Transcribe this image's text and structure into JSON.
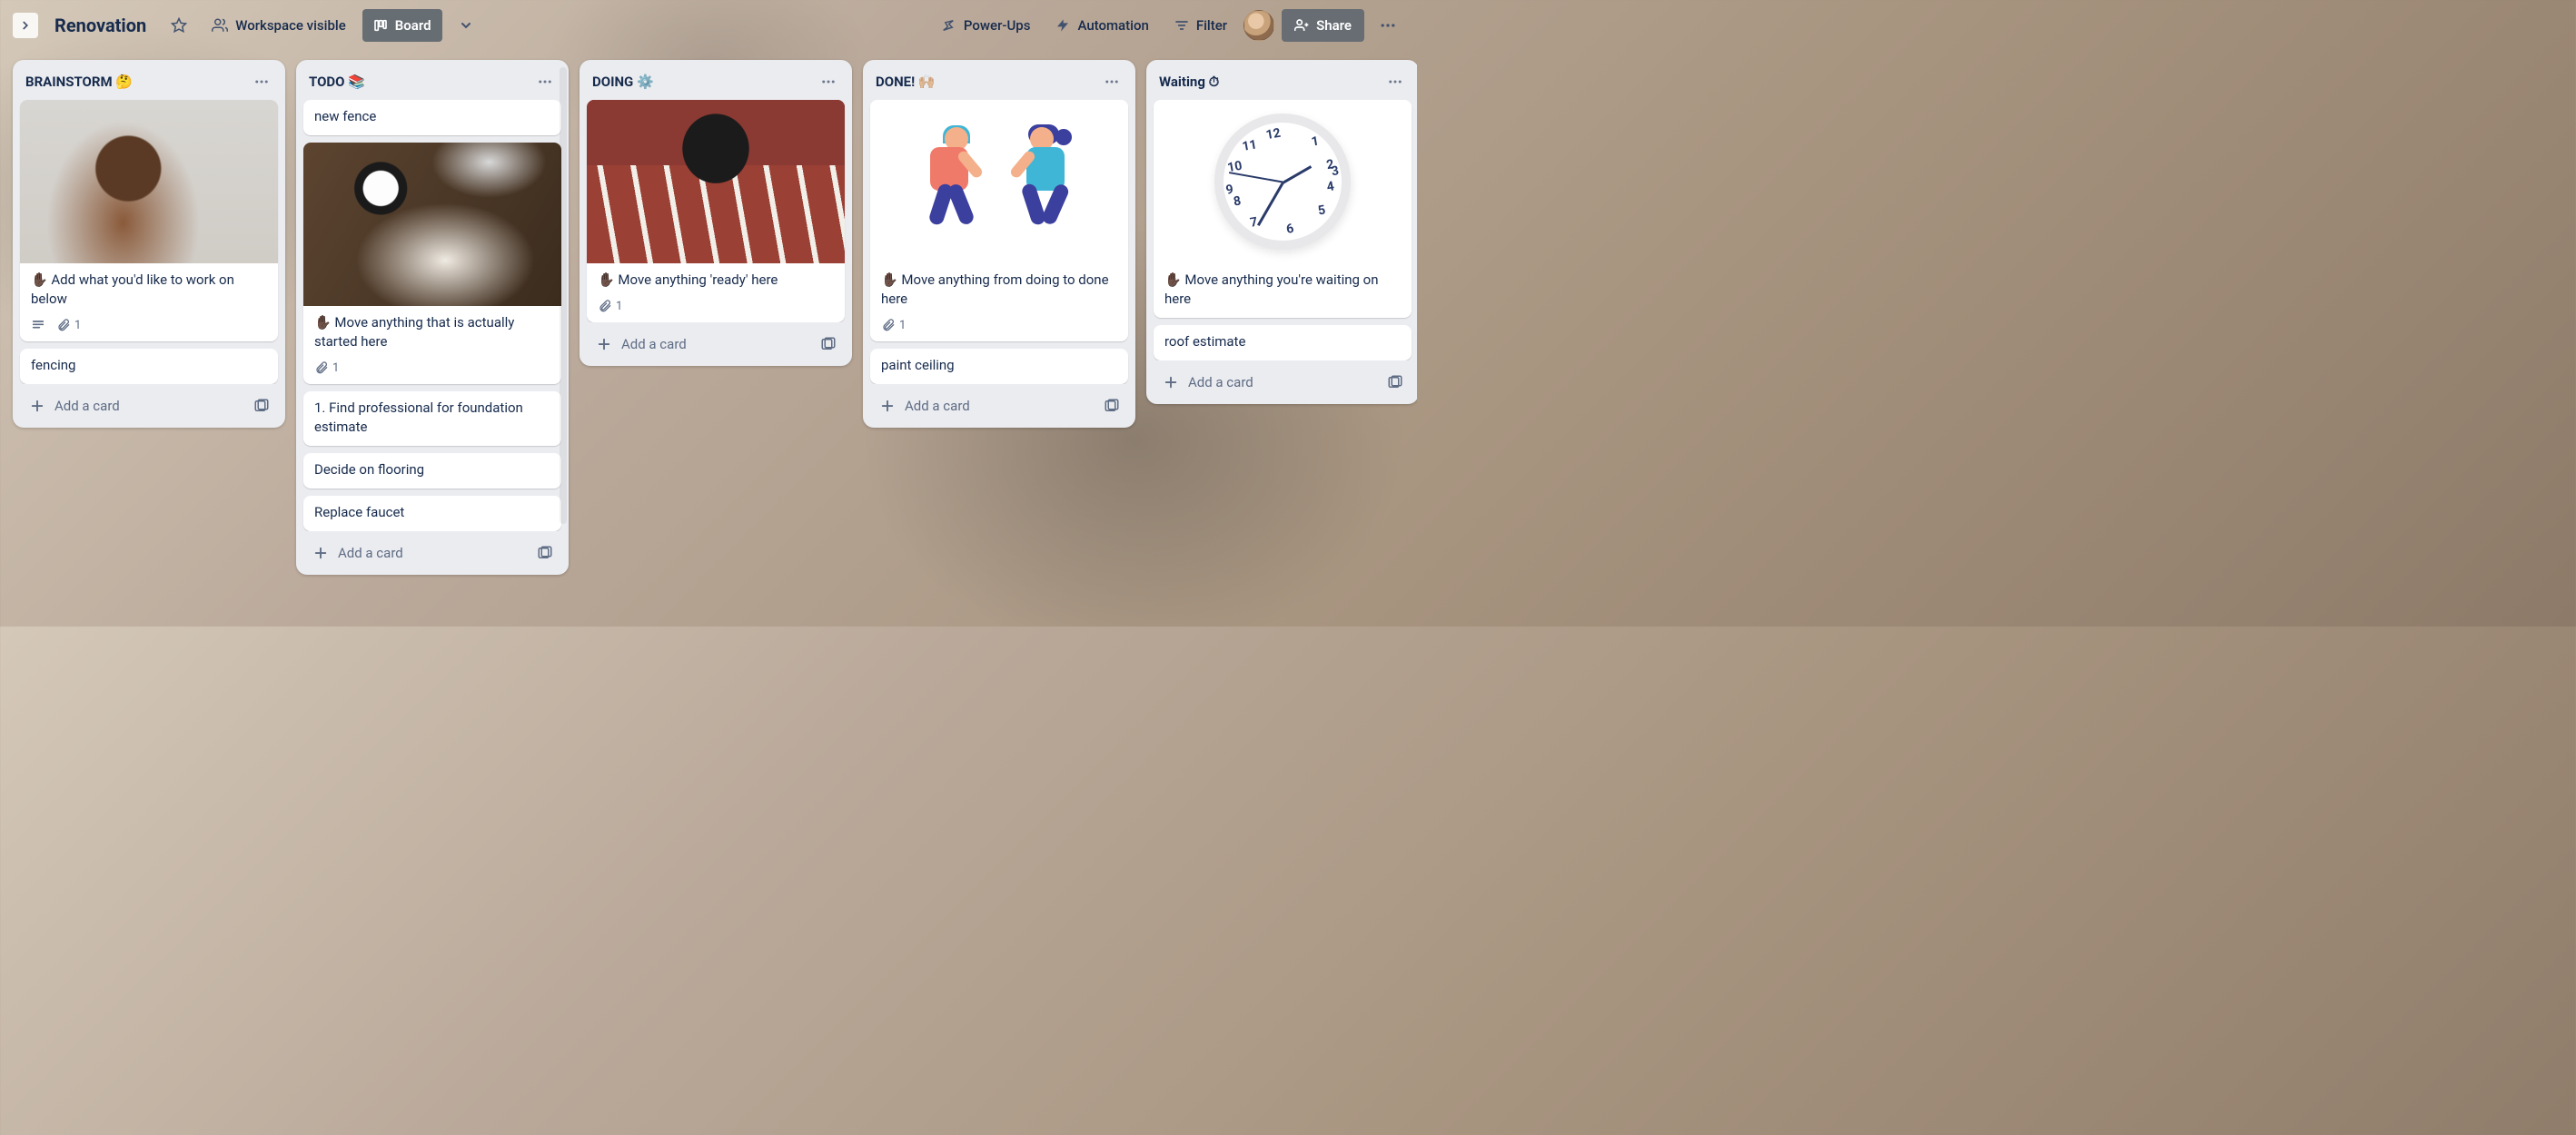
{
  "header": {
    "board_name": "Renovation",
    "workspace_visible": "Workspace visible",
    "view_label": "Board",
    "power_ups": "Power-Ups",
    "automation": "Automation",
    "filter": "Filter",
    "share": "Share"
  },
  "lists": [
    {
      "title": "BRAINSTORM 🤔",
      "cards": [
        {
          "text": "✋🏿 Add what you'd like to work on below",
          "has_cover": true,
          "badges": {
            "desc": true,
            "attach": 1
          }
        },
        {
          "text": "fencing"
        }
      ],
      "add_label": "Add a card"
    },
    {
      "title": "TODO 📚",
      "cards": [
        {
          "text": "new fence"
        },
        {
          "text": "✋🏿 Move anything that is actually started here",
          "has_cover": true,
          "badges": {
            "attach": 1
          }
        },
        {
          "text": "1. Find professional for foundation estimate"
        },
        {
          "text": "Decide on flooring"
        },
        {
          "text": "Replace faucet"
        }
      ],
      "add_label": "Add a card"
    },
    {
      "title": "DOING ⚙️",
      "cards": [
        {
          "text": "✋🏿 Move anything 'ready' here",
          "has_cover": true,
          "badges": {
            "attach": 1
          }
        }
      ],
      "add_label": "Add a card"
    },
    {
      "title": "DONE! 🙌🏼",
      "cards": [
        {
          "text": "✋🏿 Move anything from doing to done here",
          "has_cover": true,
          "badges": {
            "attach": 1
          }
        },
        {
          "text": "paint ceiling"
        }
      ],
      "add_label": "Add a card"
    },
    {
      "title": "Waiting ⏱",
      "cards": [
        {
          "text": "✋🏿 Move anything you're waiting on here",
          "has_cover": true
        },
        {
          "text": "roof estimate"
        }
      ],
      "add_label": "Add a card"
    }
  ]
}
